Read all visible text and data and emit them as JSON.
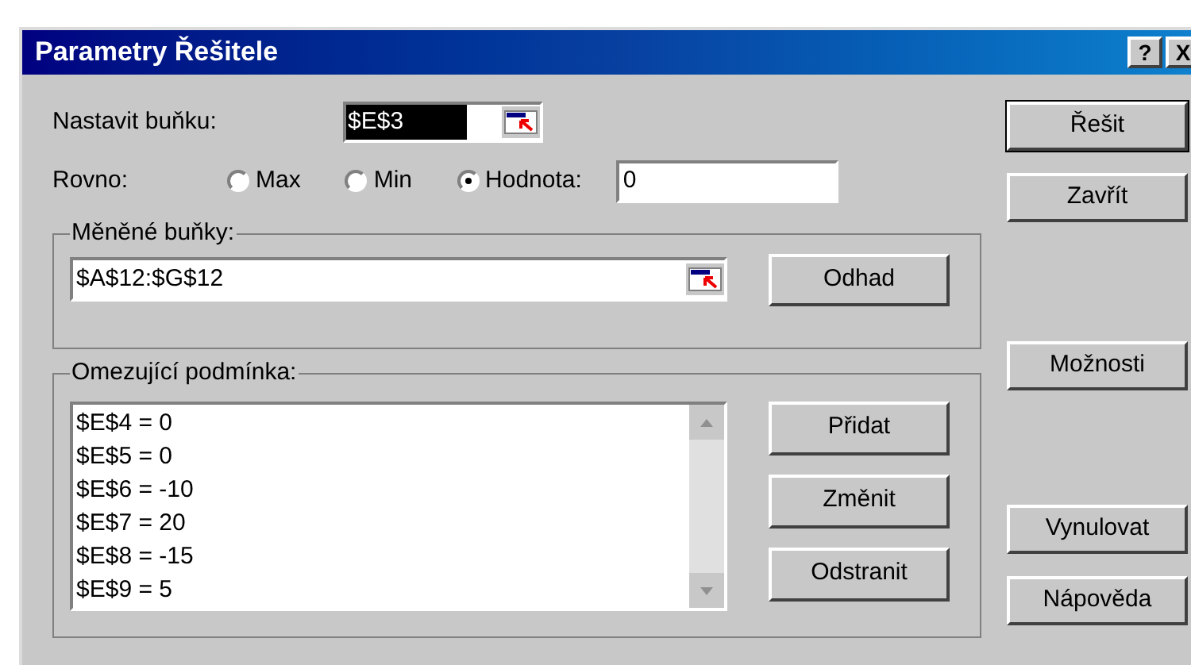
{
  "window": {
    "title": "Parametry Řešitele",
    "title_buttons": [
      "?",
      "X"
    ]
  },
  "target": {
    "label": "Nastavit buňku:",
    "value": "$E$3"
  },
  "equal": {
    "label": "Rovno:",
    "options": [
      {
        "label": "Max",
        "selected": false
      },
      {
        "label": "Min",
        "selected": false
      },
      {
        "label": "Hodnota:",
        "selected": true
      }
    ],
    "value": "0"
  },
  "changing": {
    "title": "Měněné buňky:",
    "value": "$A$12:$G$12",
    "button": "Odhad"
  },
  "constraints": {
    "title": "Omezující podmínka:",
    "items": [
      "$E$4 = 0",
      "$E$5 = 0",
      "$E$6 = -10",
      "$E$7 = 20",
      "$E$8 = -15",
      "$E$9 = 5"
    ],
    "buttons": [
      "Přidat",
      "Změnit",
      "Odstranit"
    ]
  },
  "side_buttons": [
    {
      "label": "Řešit",
      "kind": "default"
    },
    {
      "label": "Zavřít",
      "kind": "normal"
    },
    {
      "label": "Možnosti",
      "kind": "normal"
    },
    {
      "label": "Vynulovat",
      "kind": "normal"
    },
    {
      "label": "Nápověda",
      "kind": "normal"
    }
  ]
}
